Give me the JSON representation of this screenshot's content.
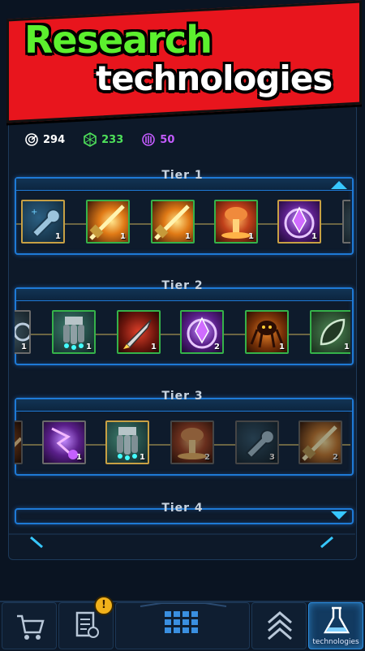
{
  "banner": {
    "line1": "Research",
    "line2": "technologies"
  },
  "resources": [
    {
      "name": "research-points",
      "value": "294",
      "color": "#ffffff",
      "icon": "radar-icon"
    },
    {
      "name": "green-crystals",
      "value": "233",
      "color": "#4ee05a",
      "icon": "crystal-icon"
    },
    {
      "name": "purple-energy",
      "value": "50",
      "color": "#c45cff",
      "icon": "energy-icon"
    }
  ],
  "tiers": [
    {
      "title": "Tier 1",
      "arrow": "up",
      "techs": [
        {
          "icon": "wrench-icon",
          "level": "1"
        },
        {
          "icon": "bullet-fire-icon",
          "level": "1"
        },
        {
          "icon": "bullet-fire-icon",
          "level": "1"
        },
        {
          "icon": "nuke-explosion-icon",
          "level": "1"
        },
        {
          "icon": "purple-crystal-icon",
          "level": "1"
        }
      ]
    },
    {
      "title": "Tier 2",
      "arrow": "up",
      "techs": [
        {
          "icon": "partial-tech-icon",
          "level": "1"
        },
        {
          "icon": "triple-missile-icon",
          "level": "1"
        },
        {
          "icon": "rocket-icon",
          "level": "1"
        },
        {
          "icon": "purple-crystal-icon",
          "level": "2"
        },
        {
          "icon": "alien-creature-icon",
          "level": "1"
        },
        {
          "icon": "green-leaf-icon",
          "level": "1"
        }
      ]
    },
    {
      "title": "Tier 3",
      "arrow": "up",
      "techs": [
        {
          "icon": "partial-tech-icon",
          "level": ""
        },
        {
          "icon": "purple-lightning-icon",
          "level": "1"
        },
        {
          "icon": "triple-missile-icon",
          "level": "1"
        },
        {
          "icon": "nuke-explosion-icon",
          "level": "2"
        },
        {
          "icon": "wrench-icon",
          "level": "3"
        },
        {
          "icon": "bullet-fire-icon",
          "level": "2"
        }
      ]
    },
    {
      "title": "Tier 4",
      "arrow": "down",
      "techs": []
    }
  ],
  "nav": {
    "shop": "",
    "missions": "",
    "alert_badge": "!",
    "center": "",
    "upgrades": "",
    "technologies": "technologies"
  }
}
